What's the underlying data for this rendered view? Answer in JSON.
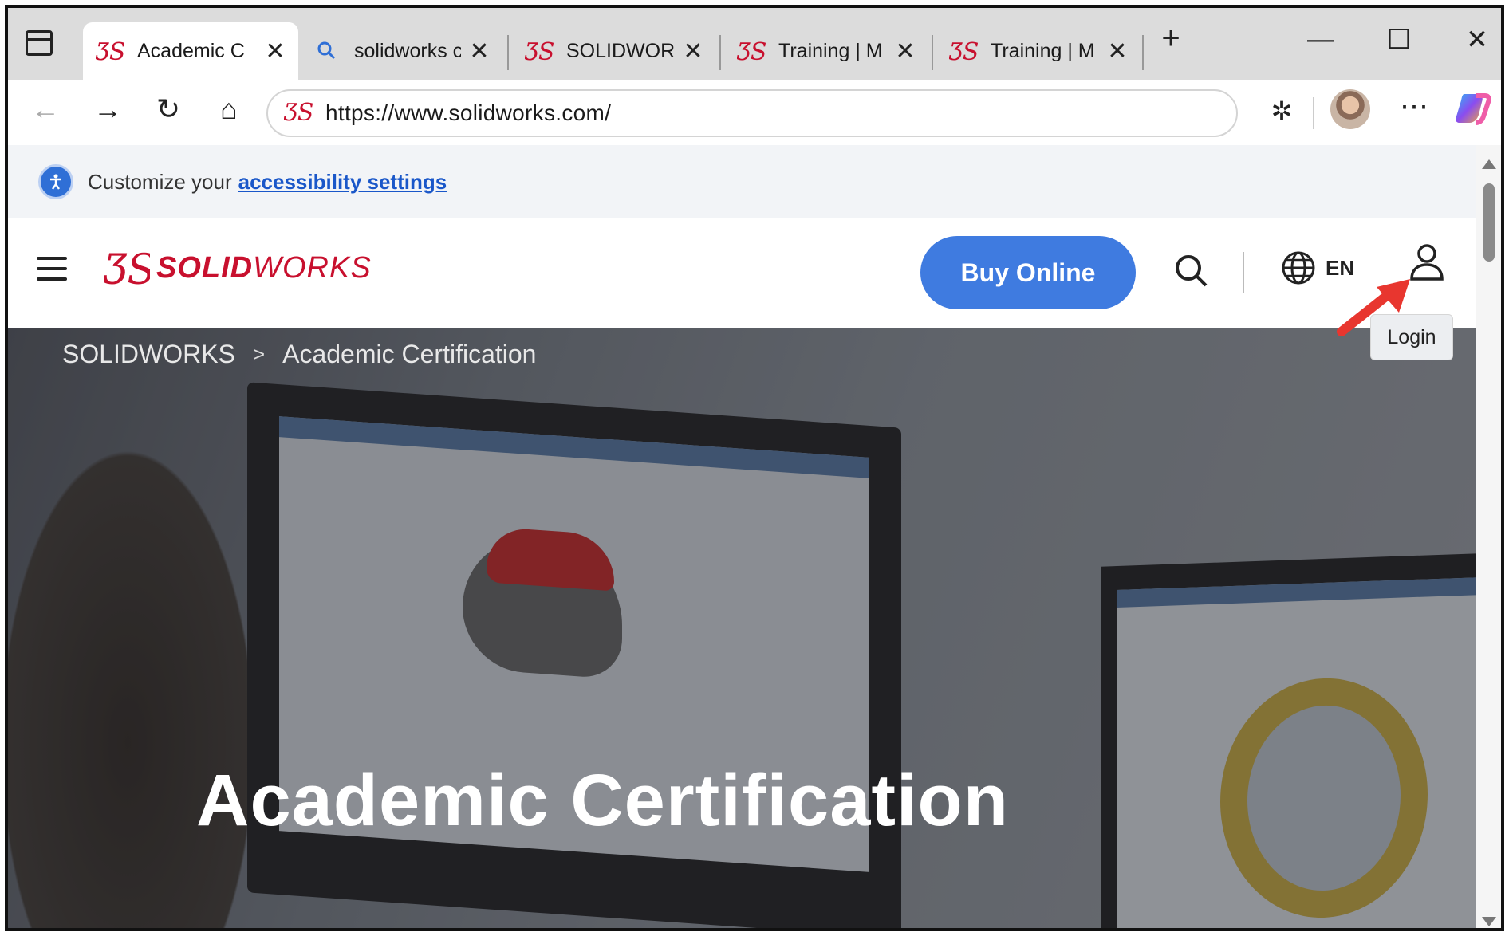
{
  "browser": {
    "tabs": [
      {
        "label": "Academic C",
        "icon": "3ds-logo-icon",
        "active": true
      },
      {
        "label": "solidworks c",
        "icon": "search-icon",
        "active": false
      },
      {
        "label": "SOLIDWOR",
        "icon": "3ds-logo-icon",
        "active": false
      },
      {
        "label": "Training | M",
        "icon": "3ds-logo-icon",
        "active": false
      },
      {
        "label": "Training | M",
        "icon": "3ds-logo-icon",
        "active": false
      }
    ],
    "url": "https://www.solidworks.com/"
  },
  "infobar": {
    "text": "Customize your",
    "link": "accessibility settings"
  },
  "header": {
    "logo_bold": "SOLID",
    "logo_light": "WORKS",
    "buy_label": "Buy Online",
    "lang": "EN",
    "login_tooltip": "Login"
  },
  "hero": {
    "breadcrumb": [
      "SOLIDWORKS",
      "Academic Certification"
    ],
    "title": "Academic Certification"
  },
  "colors": {
    "brand_red": "#c8102e",
    "buy_blue": "#3f7be0",
    "annotation_arrow": "#e8362f"
  }
}
